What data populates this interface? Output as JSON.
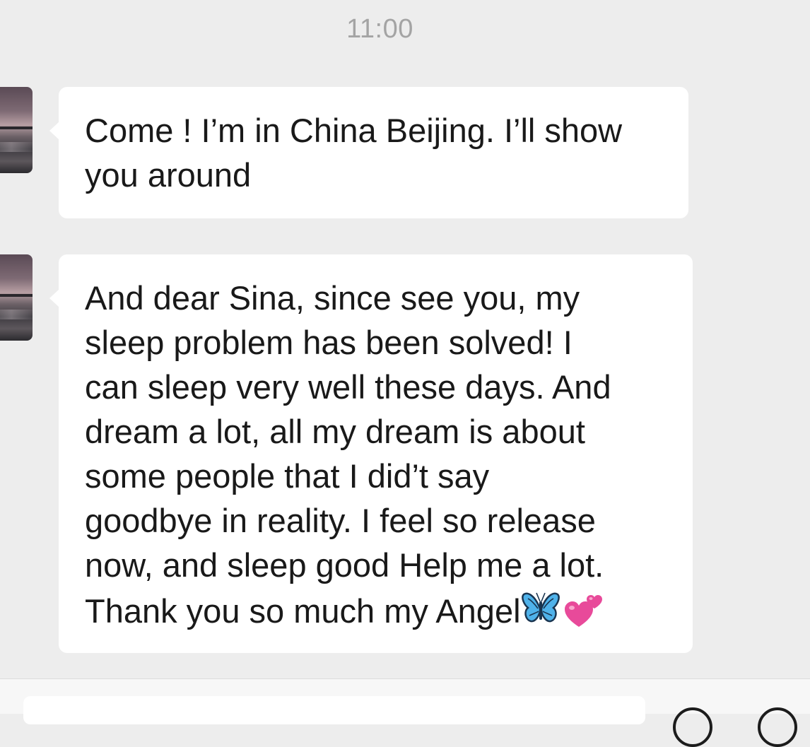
{
  "timestamp": "11:00",
  "messages": [
    {
      "lines": [
        "Come ! I’m in China Beijing. I’ll show",
        "you around"
      ]
    },
    {
      "lines": [
        "And dear Sina, since see you, my",
        "sleep problem has been solved! I",
        "can sleep very well these days. And",
        "dream a lot, all my dream is about",
        "some people that I did’t say",
        "goodbye in reality. I feel so release",
        "now, and sleep good Help me a lot.",
        "Thank you so much my Angel"
      ],
      "trailing_emojis": [
        "butterfly-emoji",
        "two-hearts-emoji"
      ]
    }
  ],
  "colors": {
    "background": "#ededed",
    "bubble": "#ffffff",
    "text": "#191919",
    "timestamp": "#a4a4a4",
    "butterfly": "#4fb2ea",
    "hearts": "#e84a9a"
  }
}
